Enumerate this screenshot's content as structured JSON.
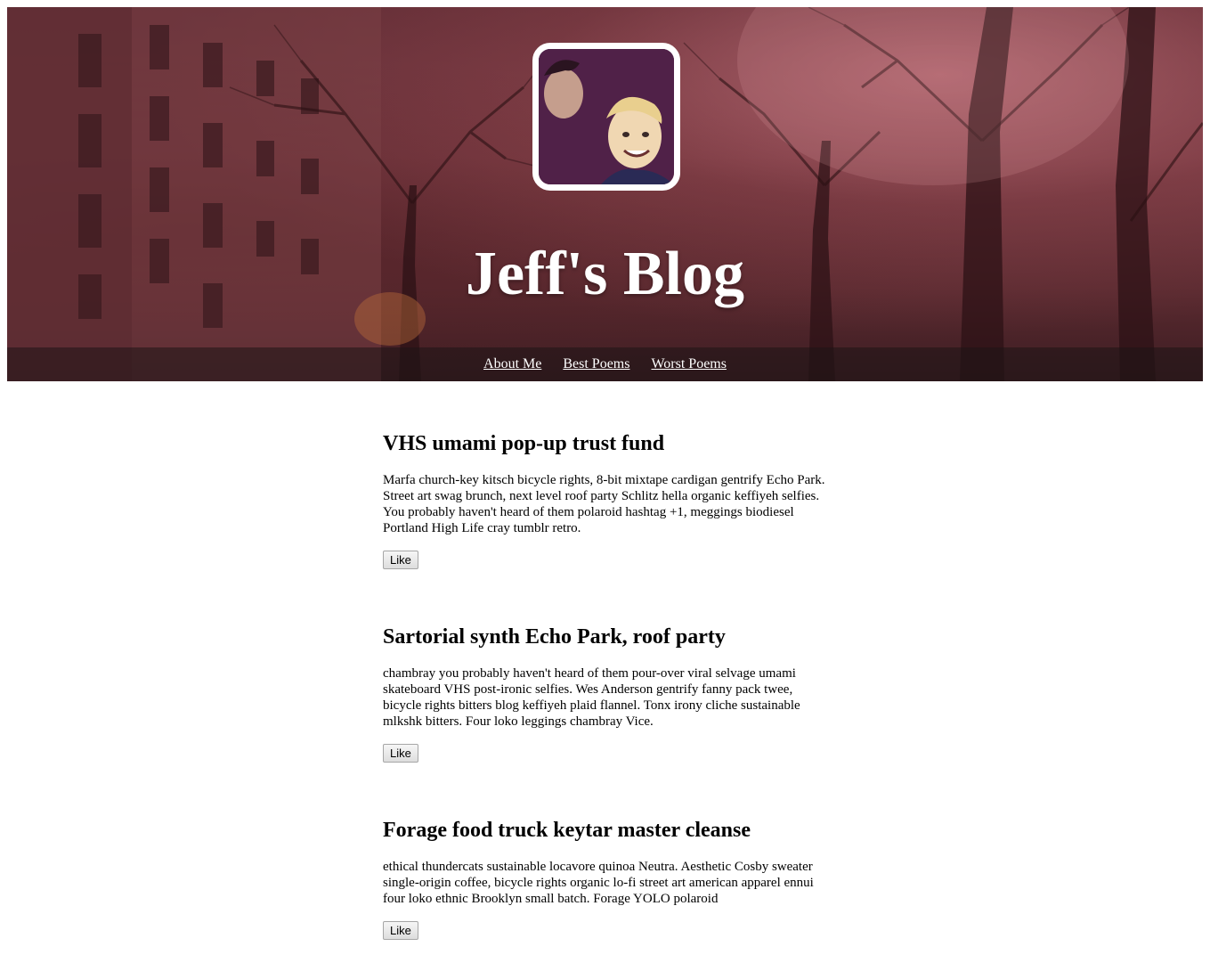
{
  "site": {
    "title": "Jeff's Blog"
  },
  "nav": {
    "items": [
      {
        "label": "About Me"
      },
      {
        "label": "Best Poems"
      },
      {
        "label": "Worst Poems"
      }
    ]
  },
  "posts": [
    {
      "title": "VHS umami pop-up trust fund",
      "body": "Marfa church-key kitsch bicycle rights, 8-bit mixtape cardigan gentrify Echo Park. Street art swag brunch, next level roof party Schlitz hella organic keffiyeh selfies. You probably haven't heard of them polaroid hashtag +1, meggings biodiesel Portland High Life cray tumblr retro.",
      "like_label": "Like"
    },
    {
      "title": "Sartorial synth Echo Park, roof party",
      "body": "chambray you probably haven't heard of them pour-over viral selvage umami skateboard VHS post-ironic selfies. Wes Anderson gentrify fanny pack twee, bicycle rights bitters blog keffiyeh plaid flannel. Tonx irony cliche sustainable mlkshk bitters. Four loko leggings chambray Vice.",
      "like_label": "Like"
    },
    {
      "title": "Forage food truck keytar master cleanse",
      "body": "ethical thundercats sustainable locavore quinoa Neutra. Aesthetic Cosby sweater single-origin coffee, bicycle rights organic lo-fi street art american apparel ennui four loko ethnic Brooklyn small batch. Forage YOLO polaroid",
      "like_label": "Like"
    }
  ],
  "colors": {
    "header_tint": "#6f353d",
    "nav_bar": "#1e1416",
    "avatar_border": "#ffffff"
  }
}
